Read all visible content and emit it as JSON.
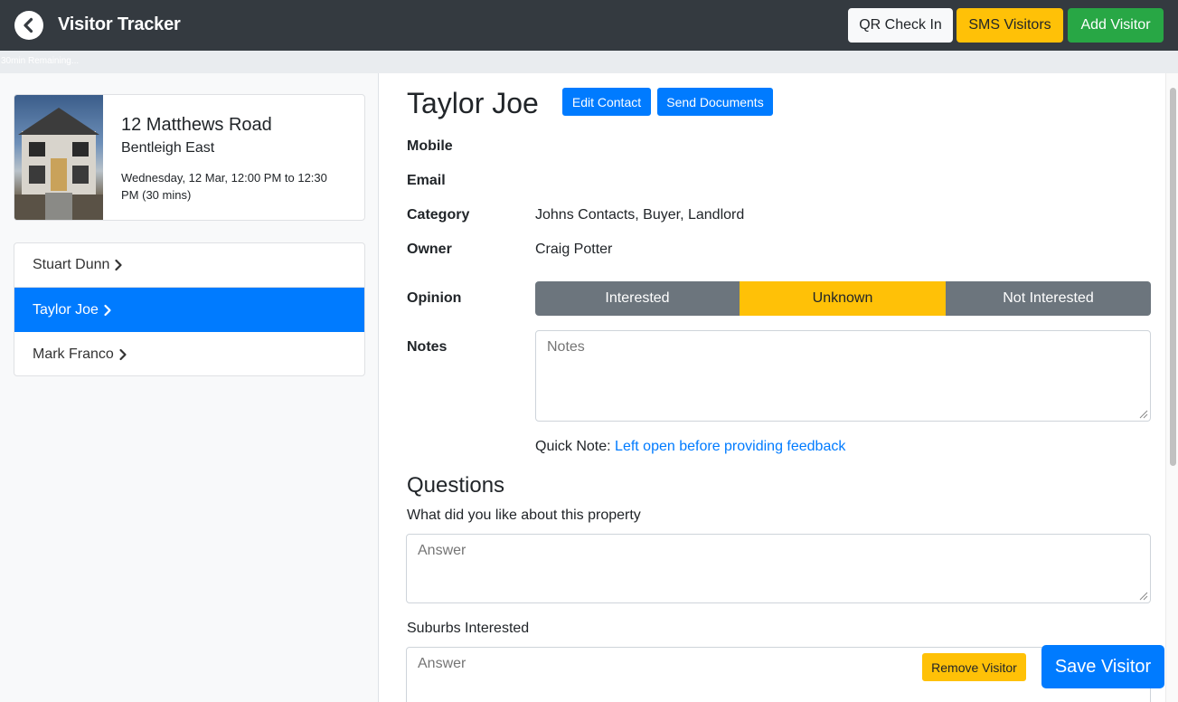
{
  "header": {
    "title": "Visitor Tracker",
    "qr_check_in": "QR Check In",
    "sms_visitors": "SMS Visitors",
    "add_visitor": "Add Visitor",
    "back_icon": "chevron-left-circle-icon"
  },
  "timer": {
    "text": "30min Remaining..."
  },
  "property": {
    "address": "12 Matthews Road",
    "suburb": "Bentleigh East",
    "time": "Wednesday, 12 Mar, 12:00 PM to 12:30 PM (30 mins)"
  },
  "visitors": [
    {
      "name": "Stuart Dunn",
      "active": false
    },
    {
      "name": "Taylor Joe",
      "active": true
    },
    {
      "name": "Mark Franco",
      "active": false
    }
  ],
  "contact": {
    "name": "Taylor Joe",
    "edit_label": "Edit Contact",
    "send_label": "Send Documents",
    "mobile_label": "Mobile",
    "mobile_value": "",
    "email_label": "Email",
    "email_value": "",
    "category_label": "Category",
    "category_value": "Johns Contacts, Buyer, Landlord",
    "owner_label": "Owner",
    "owner_value": "Craig Potter"
  },
  "opinion": {
    "label": "Opinion",
    "options": [
      "Interested",
      "Unknown",
      "Not Interested"
    ],
    "selected": "Unknown"
  },
  "notes": {
    "label": "Notes",
    "placeholder": "Notes",
    "quick_note_prefix": "Quick Note:",
    "quick_note_link": "Left open before providing feedback"
  },
  "questions": {
    "title": "Questions",
    "items": [
      {
        "question": "What did you like about this property",
        "placeholder": "Answer"
      },
      {
        "question": "Suburbs Interested",
        "placeholder": "Answer"
      }
    ]
  },
  "actions": {
    "remove_visitor": "Remove Visitor",
    "save_visitor": "Save Visitor"
  },
  "colors": {
    "header_bg": "#343a40",
    "primary": "#007bff",
    "warning": "#ffc107",
    "success": "#28a745",
    "secondary": "#6c757d"
  }
}
